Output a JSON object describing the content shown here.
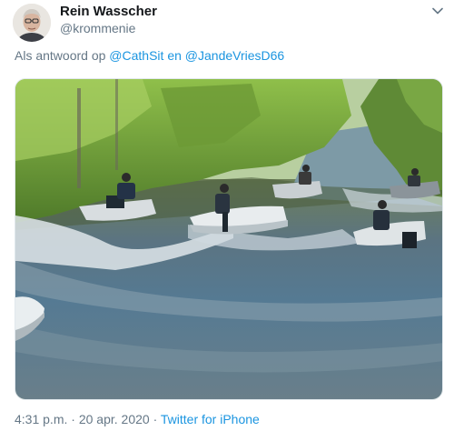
{
  "author": {
    "name": "Rein Wasscher",
    "handle": "@krommenie"
  },
  "reply": {
    "prefix": "Als antwoord op",
    "mention_1": "@CathSit",
    "conjunction": "en",
    "mention_2": "@JandeVriesD66"
  },
  "media": {
    "alt_description": ""
  },
  "meta": {
    "time": "4:31 p.m.",
    "separator_1": "·",
    "date": "20 apr. 2020",
    "separator_2": "·",
    "source": "Twitter for iPhone"
  },
  "icons": {
    "more": "chevron-down-icon"
  },
  "colors": {
    "link": "#1b95e0",
    "secondary_text": "#657786",
    "primary_text": "#14171a"
  }
}
